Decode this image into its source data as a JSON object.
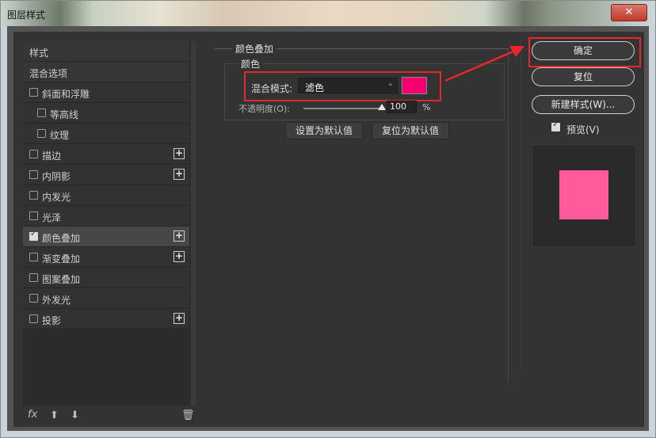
{
  "window": {
    "title": "图层样式",
    "close_glyph": "✕"
  },
  "style_list": {
    "items": [
      {
        "label": "样式",
        "checkbox": false,
        "checked": false,
        "plus": false,
        "indent": 0,
        "header": true
      },
      {
        "label": "混合选项",
        "checkbox": false,
        "checked": false,
        "plus": false,
        "indent": 0,
        "header": true
      },
      {
        "label": "斜面和浮雕",
        "checkbox": true,
        "checked": false,
        "plus": false,
        "indent": 0
      },
      {
        "label": "等高线",
        "checkbox": true,
        "checked": false,
        "plus": false,
        "indent": 1
      },
      {
        "label": "纹理",
        "checkbox": true,
        "checked": false,
        "plus": false,
        "indent": 1
      },
      {
        "label": "描边",
        "checkbox": true,
        "checked": false,
        "plus": true,
        "indent": 0
      },
      {
        "label": "内阴影",
        "checkbox": true,
        "checked": false,
        "plus": true,
        "indent": 0
      },
      {
        "label": "内发光",
        "checkbox": true,
        "checked": false,
        "plus": false,
        "indent": 0
      },
      {
        "label": "光泽",
        "checkbox": true,
        "checked": false,
        "plus": false,
        "indent": 0
      },
      {
        "label": "颜色叠加",
        "checkbox": true,
        "checked": true,
        "plus": true,
        "indent": 0,
        "active": true
      },
      {
        "label": "渐变叠加",
        "checkbox": true,
        "checked": false,
        "plus": true,
        "indent": 0
      },
      {
        "label": "图案叠加",
        "checkbox": true,
        "checked": false,
        "plus": false,
        "indent": 0
      },
      {
        "label": "外发光",
        "checkbox": true,
        "checked": false,
        "plus": false,
        "indent": 0
      },
      {
        "label": "投影",
        "checkbox": true,
        "checked": false,
        "plus": true,
        "indent": 0
      }
    ],
    "tools": {
      "fx": "fx",
      "up": "⬆",
      "down": "⬇",
      "trash": "🗑"
    }
  },
  "color_overlay": {
    "section_title": "颜色叠加",
    "sub_title": "颜色",
    "blend_label": "混合模式:",
    "blend_value": "滤色",
    "blend_chevron": "⌄",
    "swatch_color": "#f5006e",
    "opacity_label": "不透明度(O):",
    "opacity_value": "100",
    "opacity_unit": "%",
    "opacity_fraction": 1.0,
    "set_default_label": "设置为默认值",
    "reset_default_label": "复位为默认值"
  },
  "actions": {
    "ok_label": "确定",
    "reset_label": "复位",
    "new_style_label": "新建样式(W)...",
    "preview_label": "预览(V)",
    "preview_checked": true,
    "preview_color": "#ff5a9c"
  },
  "annotation_color": "#e8262c"
}
